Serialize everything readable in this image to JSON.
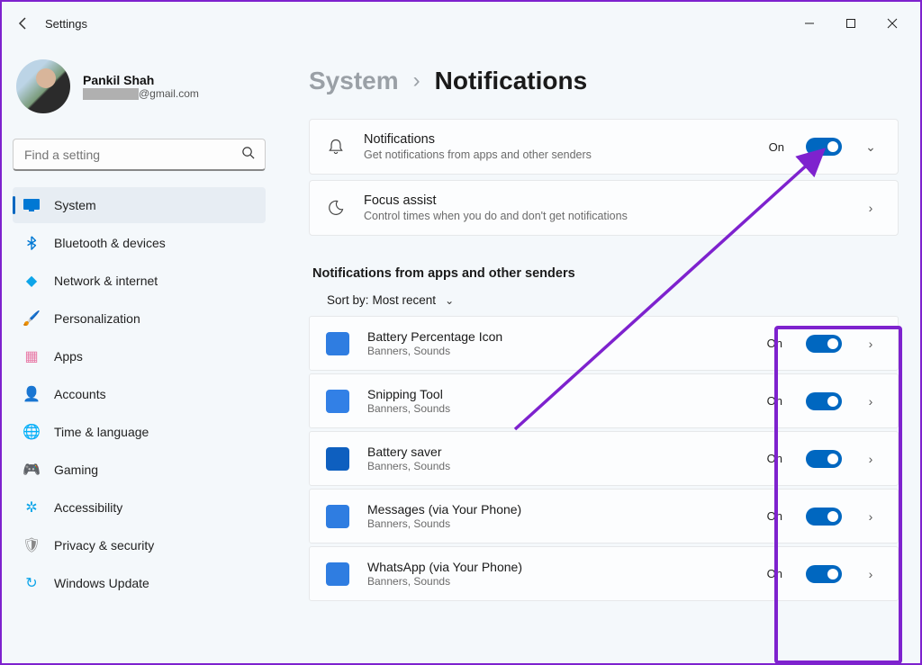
{
  "window": {
    "title": "Settings"
  },
  "profile": {
    "name": "Pankil Shah",
    "email_suffix": "@gmail.com"
  },
  "search": {
    "placeholder": "Find a setting"
  },
  "nav": [
    {
      "label": "System",
      "icon": "🖥️",
      "color": "#0078d4",
      "active": true
    },
    {
      "label": "Bluetooth & devices",
      "icon": "bt",
      "color": "#0078d4"
    },
    {
      "label": "Network & internet",
      "icon": "◆",
      "color": "#0ea5e9"
    },
    {
      "label": "Personalization",
      "icon": "🖌️",
      "color": "#c19a6b"
    },
    {
      "label": "Apps",
      "icon": "▦",
      "color": "#e879a6"
    },
    {
      "label": "Accounts",
      "icon": "👤",
      "color": "#16a34a"
    },
    {
      "label": "Time & language",
      "icon": "🌐",
      "color": "#0ea5e9"
    },
    {
      "label": "Gaming",
      "icon": "🎮",
      "color": "#888"
    },
    {
      "label": "Accessibility",
      "icon": "✲",
      "color": "#0ea5e9"
    },
    {
      "label": "Privacy & security",
      "icon": "🛡",
      "color": "#888"
    },
    {
      "label": "Windows Update",
      "icon": "↻",
      "color": "#0ea5e9"
    }
  ],
  "breadcrumb": {
    "parent": "System",
    "current": "Notifications"
  },
  "cards": {
    "notifications": {
      "title": "Notifications",
      "sub": "Get notifications from apps and other senders",
      "state": "On"
    },
    "focus": {
      "title": "Focus assist",
      "sub": "Control times when you do and don't get notifications"
    }
  },
  "section_label": "Notifications from apps and other senders",
  "sort": {
    "label": "Sort by:",
    "value": "Most recent"
  },
  "apps": [
    {
      "name": "Battery Percentage Icon",
      "sub": "Banners, Sounds",
      "state": "On",
      "icon_bg": "#2f7de1"
    },
    {
      "name": "Snipping Tool",
      "sub": "Banners, Sounds",
      "state": "On",
      "icon_bg": "#3280e6"
    },
    {
      "name": "Battery saver",
      "sub": "Banners, Sounds",
      "state": "On",
      "icon_bg": "#0e5fbf"
    },
    {
      "name": "Messages (via Your Phone)",
      "sub": "Banners, Sounds",
      "state": "On",
      "icon_bg": "#2f7de1"
    },
    {
      "name": "WhatsApp (via Your Phone)",
      "sub": "Banners, Sounds",
      "state": "On",
      "icon_bg": "#2f7de1"
    }
  ]
}
